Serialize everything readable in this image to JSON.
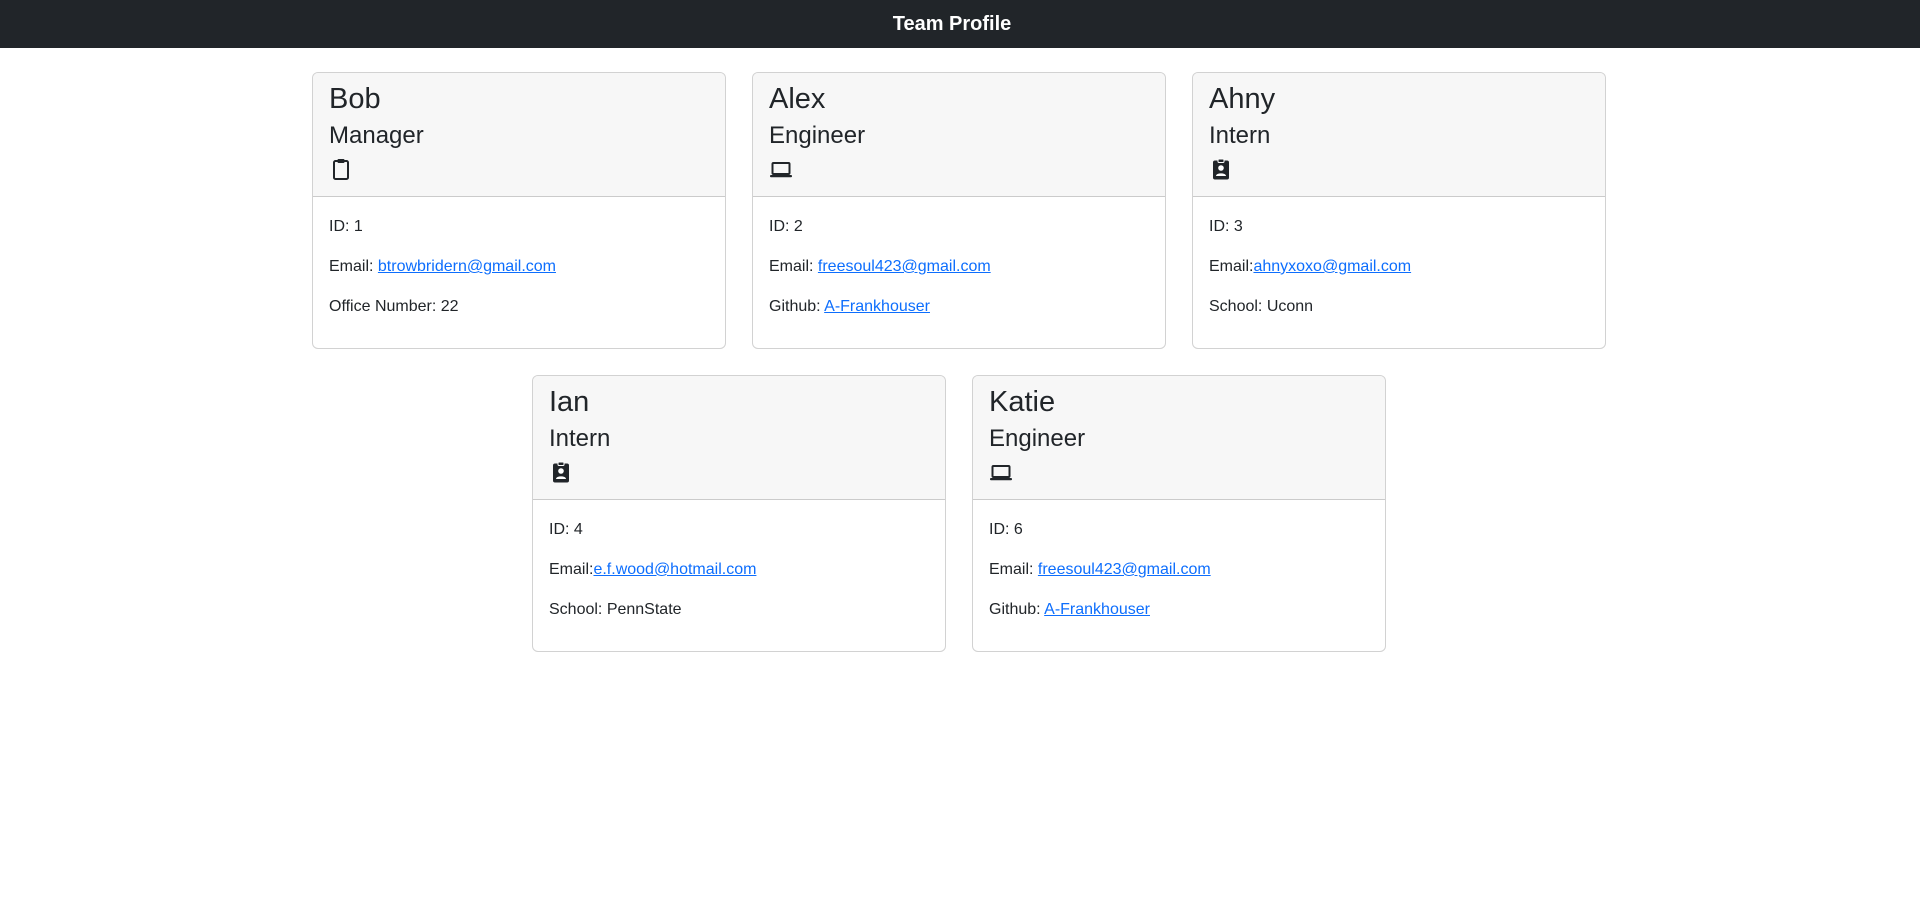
{
  "header": {
    "title": "Team Profile"
  },
  "members": [
    {
      "name": "Bob",
      "role": "Manager",
      "icon": "clipboard-icon",
      "id_text": "ID: 1",
      "email_label": "Email: ",
      "email": "btrowbridern@gmail.com",
      "extra_label": "Office Number: 22",
      "extra_link": ""
    },
    {
      "name": "Alex",
      "role": "Engineer",
      "icon": "laptop-icon",
      "id_text": "ID: 2",
      "email_label": "Email: ",
      "email": "freesoul423@gmail.com",
      "extra_label": "Github: ",
      "extra_link": "A-Frankhouser"
    },
    {
      "name": "Ahny",
      "role": "Intern",
      "icon": "id-badge-icon",
      "id_text": "ID: 3",
      "email_label": "Email:",
      "email": "ahnyxoxo@gmail.com",
      "extra_label": "School: Uconn",
      "extra_link": ""
    },
    {
      "name": "Ian",
      "role": "Intern",
      "icon": "id-badge-icon",
      "id_text": "ID: 4",
      "email_label": "Email:",
      "email": "e.f.wood@hotmail.com",
      "extra_label": "School: PennState",
      "extra_link": ""
    },
    {
      "name": "Katie",
      "role": "Engineer",
      "icon": "laptop-icon",
      "id_text": "ID: 6",
      "email_label": "Email: ",
      "email": "freesoul423@gmail.com",
      "extra_label": "Github: ",
      "extra_link": "A-Frankhouser"
    }
  ]
}
